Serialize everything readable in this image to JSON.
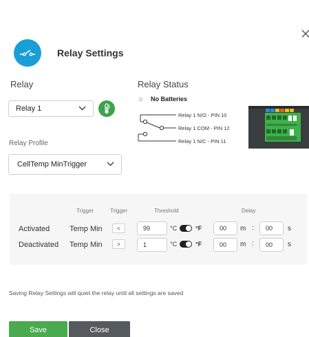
{
  "dialog": {
    "title": "Relay Settings"
  },
  "relay": {
    "label": "Relay",
    "selected": "Relay 1"
  },
  "relay_profile": {
    "label": "Relay Profile",
    "selected": "CellTemp MinTrigger"
  },
  "relay_status": {
    "label": "Relay Status",
    "status_text": "No Batteries",
    "pins": {
      "no": "Relay 1 N/O - PIN 10",
      "com": "Relay 1 COM - PIN 12",
      "nc": "Relay 1 N/C - PIN 11"
    }
  },
  "thresholds": {
    "headers": {
      "trigger": "Trigger",
      "trigger_op": "Trigger",
      "threshold": "Threshold",
      "delay": "Delay"
    },
    "celsius_label": "°C",
    "fahrenheit_label": "°F",
    "minutes_label": "m",
    "colon": ":",
    "seconds_label": "s",
    "rows": [
      {
        "label": "Activated",
        "trigger": "Temp Min",
        "operator": "<",
        "threshold": "99",
        "delay_minutes": "00",
        "delay_seconds": "00"
      },
      {
        "label": "Deactivated",
        "trigger": "Temp Min",
        "operator": ">",
        "threshold": "1",
        "delay_minutes": "00",
        "delay_seconds": "00"
      }
    ]
  },
  "note": "Saving Relay Settings will quiet the relay until all settings are saved",
  "buttons": {
    "save": "Save",
    "close": "Close"
  },
  "colors": {
    "accent_blue": "#1a9ed8",
    "save_green": "#4aaa4f",
    "close_gray": "#555a5e"
  }
}
